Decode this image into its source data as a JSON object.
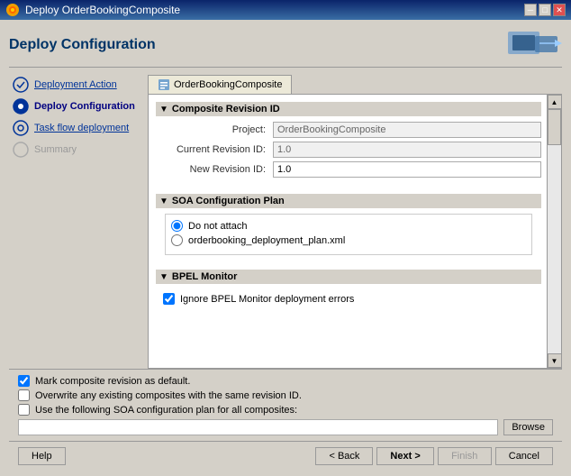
{
  "titleBar": {
    "title": "Deploy OrderBookingComposite",
    "closeLabel": "✕",
    "minimizeLabel": "─",
    "maximizeLabel": "□"
  },
  "pageTitle": "Deploy Configuration",
  "nav": {
    "items": [
      {
        "id": "deployment-action",
        "label": "Deployment Action",
        "state": "link"
      },
      {
        "id": "deploy-configuration",
        "label": "Deploy Configuration",
        "state": "active"
      },
      {
        "id": "task-flow-deployment",
        "label": "Task flow deployment",
        "state": "link"
      },
      {
        "id": "summary",
        "label": "Summary",
        "state": "disabled"
      }
    ]
  },
  "tab": {
    "label": "OrderBookingComposite"
  },
  "sections": {
    "compositeRevisionId": {
      "title": "Composite Revision ID",
      "project": {
        "label": "Project:",
        "value": "OrderBookingComposite"
      },
      "currentRevisionId": {
        "label": "Current Revision ID:",
        "value": "1.0"
      },
      "newRevisionId": {
        "label": "New Revision ID:",
        "value": "1.0"
      }
    },
    "soaConfigPlan": {
      "title": "SOA Configuration Plan",
      "options": [
        {
          "id": "do-not-attach",
          "label": "Do not attach",
          "selected": true
        },
        {
          "id": "deployment-plan",
          "label": "orderbooking_deployment_plan.xml",
          "selected": false
        }
      ]
    },
    "bpelMonitor": {
      "title": "BPEL Monitor",
      "checkbox": {
        "label": "Ignore BPEL Monitor deployment errors",
        "checked": true
      }
    }
  },
  "bottomCheckboxes": [
    {
      "id": "mark-default",
      "label": "Mark composite revision as default.",
      "checked": true
    },
    {
      "id": "overwrite",
      "label": "Overwrite any existing composites with the same revision ID.",
      "checked": false
    },
    {
      "id": "soa-plan",
      "label": "Use the following SOA configuration plan for all composites:",
      "checked": false
    }
  ],
  "bottomInput": {
    "placeholder": "",
    "browseLabel": "Browse"
  },
  "footer": {
    "helpLabel": "Help",
    "backLabel": "< Back",
    "nextLabel": "Next >",
    "finishLabel": "Finish",
    "cancelLabel": "Cancel"
  }
}
